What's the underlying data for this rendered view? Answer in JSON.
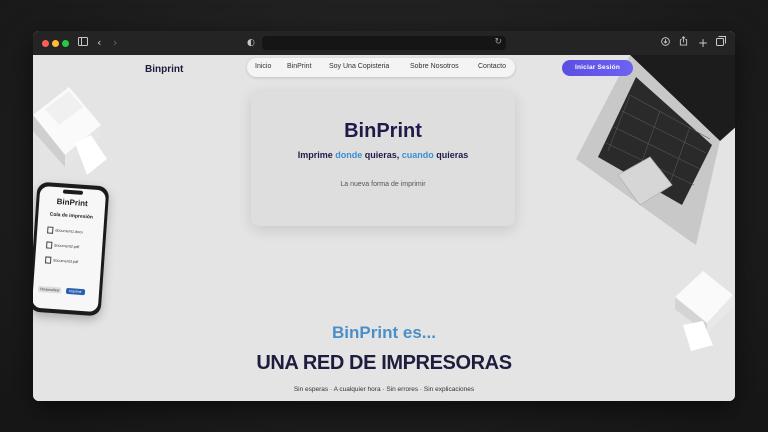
{
  "browser": {
    "back_icon": "chevron-left-icon",
    "forward_icon": "chevron-right-icon",
    "sidebar_icon": "sidebar-icon",
    "shield_icon": "shield-icon",
    "reload_icon": "reload-icon",
    "toolbar_icons": [
      "download-icon",
      "share-icon",
      "new-tab-icon",
      "tabs-overview-icon"
    ]
  },
  "header": {
    "logo": "Binprint",
    "nav": [
      "Inicio",
      "BinPrint",
      "Soy Una Copisteria",
      "Sobre Nosotros",
      "Contacto"
    ],
    "login_label": "Iniciar Sesión",
    "accent_color": "#5b4fe0"
  },
  "hero": {
    "title": "BinPrint",
    "subtitle_parts": [
      "Imprime ",
      "donde",
      " quieras, ",
      "cuando",
      " quieras"
    ],
    "tagline": "La nueva forma de imprimir",
    "highlight_color": "#3a8fd0"
  },
  "phone": {
    "title": "BinPrint",
    "subtitle": "Cola de impresión",
    "files": [
      "document1.docx",
      "document2.pdf",
      "document3.pdf"
    ],
    "button_secondary": "Personalizar",
    "button_primary": "Imprimir"
  },
  "section": {
    "lead": "BinPrint es...",
    "headline": "UNA RED DE IMPRESORAS",
    "features": "Sin esperas · A cualquier hora · Sin errores · Sin explicaciones"
  }
}
